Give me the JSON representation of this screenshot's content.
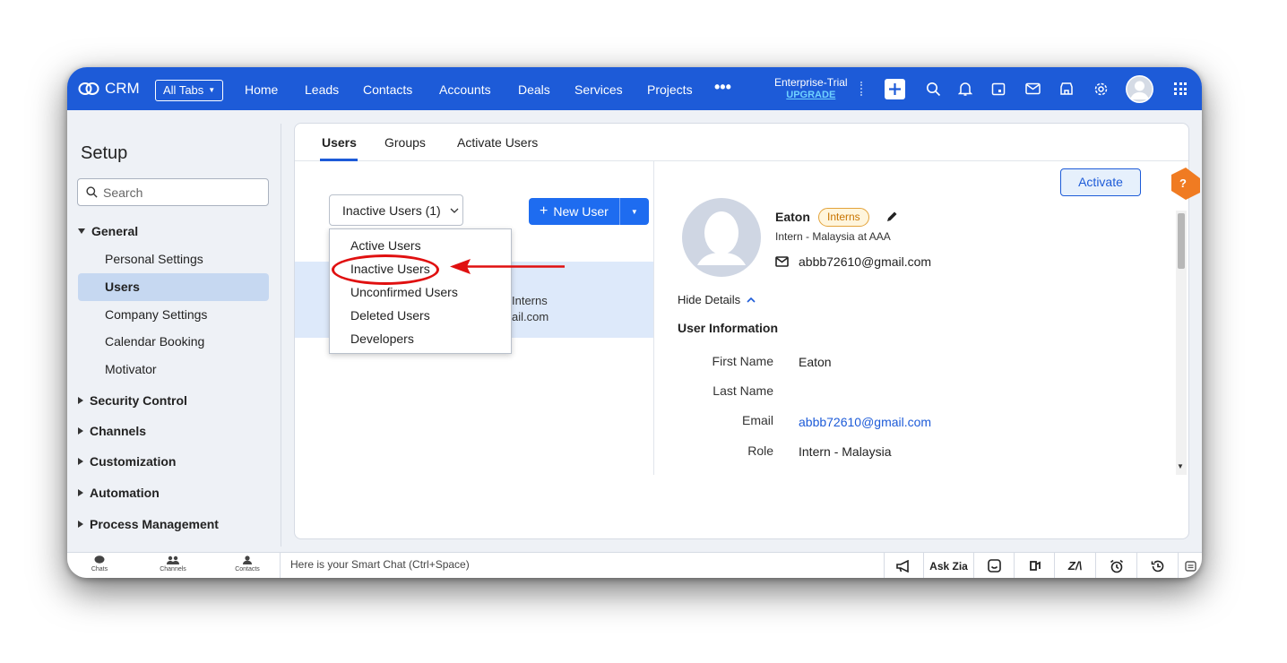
{
  "colors": {
    "brand_blue": "#1d5bd8",
    "upgrade": "#6fd2ff",
    "badge_orange": "#c87400",
    "annotation_red": "#e01010",
    "link_blue": "#1d5bd8"
  },
  "topbar": {
    "logo_text": "CRM",
    "all_tabs": "All Tabs",
    "nav": [
      "Home",
      "Leads",
      "Contacts",
      "Accounts",
      "Deals",
      "Services",
      "Projects"
    ],
    "more_icon": "ellipsis-icon",
    "plan": "Enterprise-Trial",
    "upgrade": "UPGRADE",
    "icons": [
      "plus-icon",
      "search-icon",
      "bell-icon",
      "calendar-icon",
      "mail-icon",
      "marketplace-icon",
      "gear-icon",
      "avatar",
      "apps-grid-icon"
    ]
  },
  "sidebar": {
    "title": "Setup",
    "search_placeholder": "Search",
    "general": "General",
    "general_items": [
      "Personal Settings",
      "Users",
      "Company Settings",
      "Calendar Booking",
      "Motivator"
    ],
    "active_item": "Users",
    "sections": [
      "Security Control",
      "Channels",
      "Customization",
      "Automation",
      "Process Management"
    ]
  },
  "main": {
    "tabs": [
      "Users",
      "Groups",
      "Activate Users"
    ],
    "active_tab": "Users",
    "status_select": "Inactive Users (1)",
    "new_user": "New User",
    "dropdown": [
      "Active Users",
      "Inactive Users",
      "Unconfirmed Users",
      "Deleted Users",
      "Developers"
    ],
    "highlighted_option": "Inactive Users",
    "row_partial": [
      "Interns",
      "ail.com"
    ],
    "activate": "Activate",
    "user": {
      "name": "Eaton",
      "badge": "Interns",
      "role_line": "Intern - Malaysia at AAA",
      "email": "abbb72610@gmail.com"
    },
    "hide_details": "Hide Details",
    "user_info_title": "User Information",
    "fields": [
      {
        "label": "First Name",
        "value": "Eaton"
      },
      {
        "label": "Last Name",
        "value": ""
      },
      {
        "label": "Email",
        "value": "abbb72610@gmail.com"
      },
      {
        "label": "Role",
        "value": "Intern - Malaysia"
      }
    ],
    "help": "?"
  },
  "bottombar": {
    "left": [
      "Chats",
      "Channels",
      "Contacts"
    ],
    "smartchat": "Here is your Smart Chat (Ctrl+Space)",
    "ask_zia": "Ask Zia",
    "icons": [
      "announcement-icon",
      "zia-icon",
      "signals-icon",
      "zia-logo-icon",
      "alarm-icon",
      "history-icon",
      "notes-icon"
    ]
  }
}
